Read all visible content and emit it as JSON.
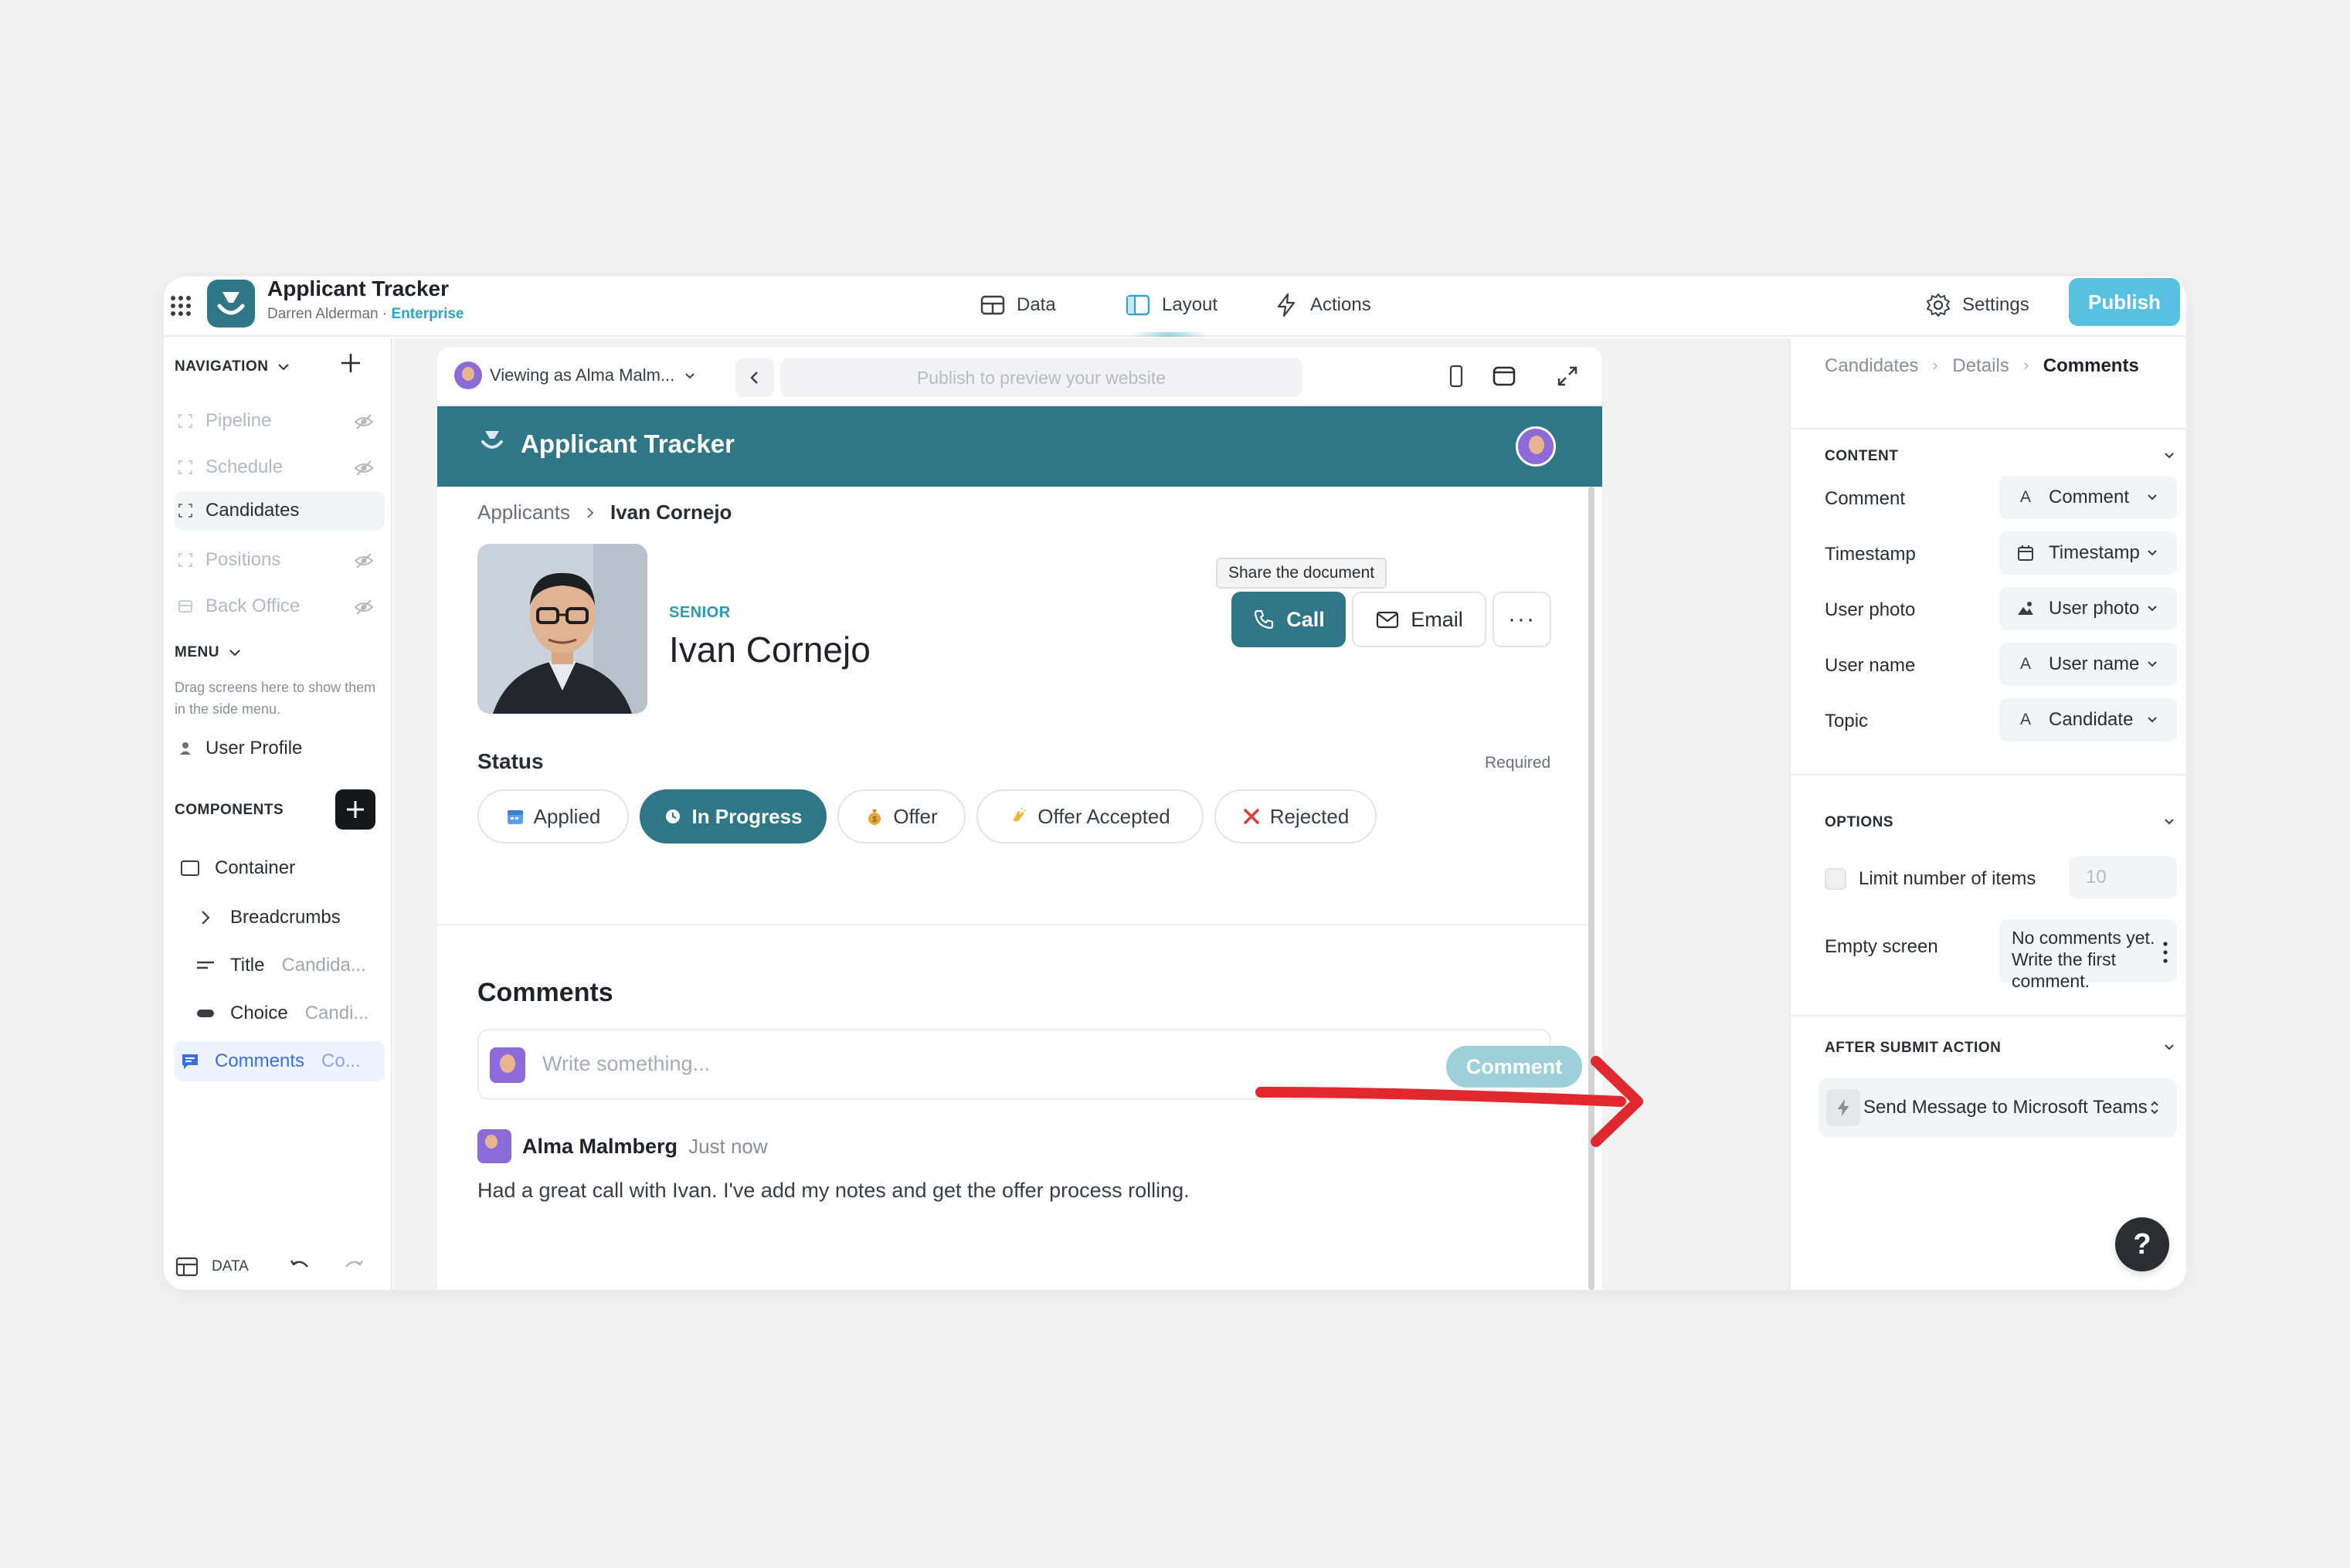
{
  "app": {
    "name": "Applicant Tracker",
    "user": "Darren Alderman",
    "separator": " · ",
    "plan": "Enterprise"
  },
  "topnav": {
    "data_label": "Data",
    "layout_label": "Layout",
    "actions_label": "Actions",
    "settings_label": "Settings",
    "publish_label": "Publish"
  },
  "sidebar": {
    "navigation_heading": "NAVIGATION",
    "nav_items": [
      {
        "label": "Pipeline",
        "hidden": true
      },
      {
        "label": "Schedule",
        "hidden": true
      },
      {
        "label": "Candidates",
        "hidden": false
      },
      {
        "label": "Positions",
        "hidden": true
      },
      {
        "label": "Back Office",
        "hidden": true
      }
    ],
    "menu_heading": "MENU",
    "menu_hint": "Drag screens here to show them in the side menu.",
    "menu_item": "User Profile",
    "components_heading": "COMPONENTS",
    "components": [
      {
        "label": "Container",
        "detail": ""
      },
      {
        "label": "Breadcrumbs",
        "detail": ""
      },
      {
        "label": "Title",
        "detail": "Candida..."
      },
      {
        "label": "Choice",
        "detail": "Candi..."
      },
      {
        "label": "Comments",
        "detail": "Co..."
      }
    ],
    "footer_data": "DATA"
  },
  "preview": {
    "viewing_as": "Viewing as Alma Malm...",
    "url_placeholder": "Publish to preview your website",
    "header_title": "Applicant Tracker",
    "breadcrumb_root": "Applicants",
    "breadcrumb_current": "Ivan Cornejo",
    "tag": "SENIOR",
    "candidate_name": "Ivan Cornejo",
    "tooltip": "Share the document",
    "call_label": "Call",
    "email_label": "Email",
    "more_label": "···",
    "status_label": "Status",
    "required_label": "Required",
    "status_options": [
      {
        "label": "Applied",
        "icon": "calendar-icon",
        "color": "#5aa0f0"
      },
      {
        "label": "In Progress",
        "icon": "clock-icon",
        "color": "#ffffff"
      },
      {
        "label": "Offer",
        "icon": "money-bag-icon",
        "color": "#e6a93a"
      },
      {
        "label": "Offer Accepted",
        "icon": "clap-icon",
        "color": "#f0b43c"
      },
      {
        "label": "Rejected",
        "icon": "x-icon",
        "color": "#e23b3b"
      }
    ],
    "selected_status": "In Progress",
    "comments_title": "Comments",
    "comment_placeholder": "Write something...",
    "comment_button": "Comment",
    "comments": [
      {
        "author": "Alma Malmberg",
        "time": "Just now",
        "text": "Had a great call with Ivan. I've add my notes and get the offer process rolling."
      }
    ]
  },
  "rpanel": {
    "breadcrumbs": [
      "Candidates",
      "Details",
      "Comments"
    ],
    "content_heading": "CONTENT",
    "content_rows": [
      {
        "label": "Comment",
        "glyph": "A",
        "value": "Comment"
      },
      {
        "label": "Timestamp",
        "glyph": "calendar",
        "value": "Timestamp"
      },
      {
        "label": "User photo",
        "glyph": "image",
        "value": "User photo"
      },
      {
        "label": "User name",
        "glyph": "A",
        "value": "User name"
      },
      {
        "label": "Topic",
        "glyph": "A",
        "value": "Candidate"
      }
    ],
    "options_heading": "OPTIONS",
    "limit_label": "Limit number of items",
    "limit_value": "10",
    "empty_label": "Empty screen",
    "empty_value": "No comments yet. Write the first comment.",
    "after_heading": "AFTER SUBMIT ACTION",
    "action_value": "Send Message to Microsoft Teams"
  },
  "help_label": "?",
  "colors": {
    "brand": "#2f7686",
    "publish": "#58c1e0",
    "annotation_arrow": "#e0282e"
  }
}
